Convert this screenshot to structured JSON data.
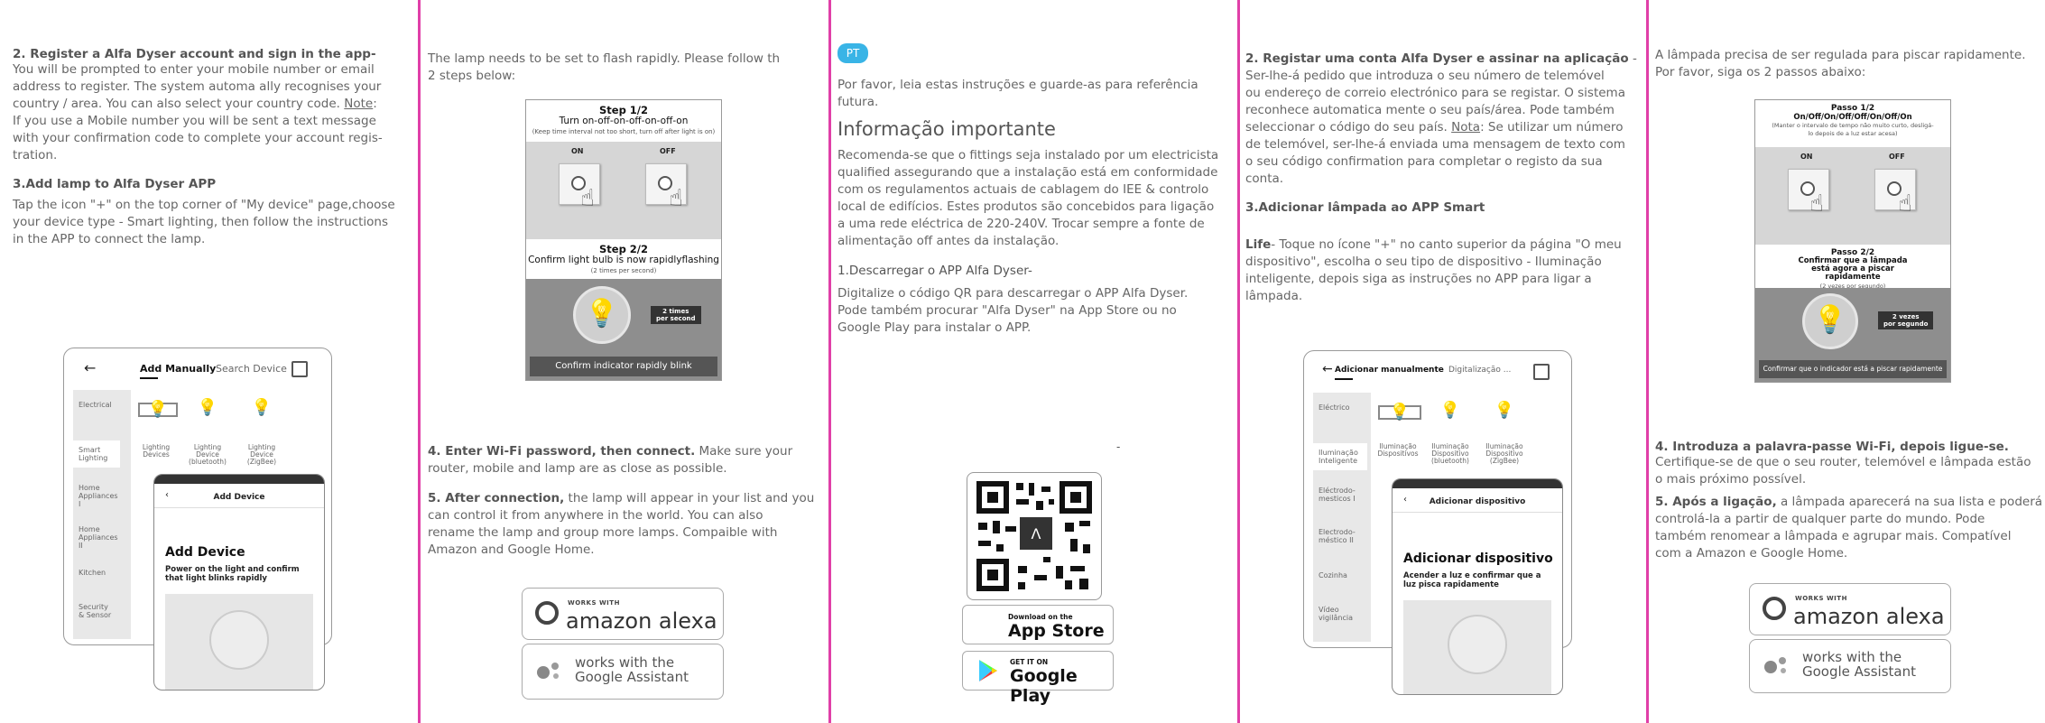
{
  "p1": {
    "h2": "2. Register a Alfa Dyser account and sign in the app-",
    "t2a": "You will be prompted to enter your mobile number or email",
    "t2b": "address to register. The system automa ally recognises your",
    "t2c": "country / area. You can also select your country code.",
    "note": "Note",
    "t2d": ":",
    "t2e": "If you use a Mobile number you will be sent a text message",
    "t2f": "with your confirmation code to complete your account regis-",
    "t2g": "tration.",
    "h3": "3.Add lamp to Alfa Dyser APP",
    "t3a": "Tap the icon \"+\" on the top corner of \"My device\" page,choose",
    "t3b": "your device type - Smart  lighting, then follow the instructions",
    "t3c": "in the APP to  connect the lamp.",
    "phone": {
      "back": "←",
      "add_manually": "Add Manually",
      "search_device": "Search Device",
      "side": [
        "Electrical",
        "Smart Lighting",
        "Home Appliances I",
        "Home Appliances II",
        "Kitchen",
        "Security & Sensor"
      ],
      "tiles": [
        "Lighting Devices",
        "Lighting Device (bluetooth)",
        "Lighting Device (ZigBee)"
      ],
      "inner_header": "Add Device",
      "inner_title": "Add Device",
      "inner_desc": "Power on the light and confirm that light blinks rapidly"
    }
  },
  "p2": {
    "intro_a": "The lamp needs to be set to flash rapidly. Please follow th",
    "intro_b": "2 steps below:",
    "step1": "Step 1/2",
    "step1_text": "Turn on-off-on-off-on-off-on",
    "step1_small": "(Keep time interval not too short, turn off after light is on)",
    "on": "ON",
    "off": "OFF",
    "step2": "Step 2/2",
    "step2_text": "Confirm light bulb is now rapidlyflashing",
    "step2_small": "(2 times per second)",
    "tag": "2 times\nper second",
    "confirm": "Confirm indicator rapidly blink",
    "h4": "4. Enter Wi-Fi password, then connect.",
    "t4a": " Make sure your",
    "t4b": "router, mobile and lamp are as close as possible.",
    "h5": "5. After connection,",
    "t5a": " the lamp will appear in your list and you",
    "t5b": "can control it from anywhere in  the world.  You can also",
    "t5c": "rename the lamp and group more lamps. Compaible with",
    "t5d": "Amazon and Google Home."
  },
  "p3": {
    "badge": "PT",
    "t1a": "Por favor, leia estas instruções e guarde-as para referência",
    "t1b": "futura.",
    "big": "Informação importante",
    "t2a": "Recomenda-se que o fittings seja instalado por um electricista",
    "t2b": "qualified assegurando que a instalação está em conformidade",
    "t2c": "com os regulamentos actuais de cablagem do IEE & controlo",
    "t2d": "local  de edifícios. Estes produtos são concebidos para ligação",
    "t2e": "a uma rede eléctrica de 220-240V. Trocar sempre a fonte de",
    "t2f": "alimentação off antes da instalação.",
    "h3": "1.Descarregar o APP Alfa Dyser-",
    "t3a": "Digitalize o código QR para descarregar o APP Alfa Dyser.",
    "t3b": "Pode também procurar \"Alfa Dyser\" na App Store ou no",
    "t3c": "Google  Play para instalar o APP.",
    "dash": "-",
    "appstore_small": "Download on the",
    "appstore_big": "App Store",
    "gplay_small": "GET IT ON",
    "gplay_big": "Google Play"
  },
  "p4": {
    "h2": "2. Registar uma conta Alfa Dyser e assinar na aplicação",
    "h2b": " -",
    "t2a": "Ser-lhe-á pedido que introduza o seu número de telemóvel",
    "t2b": "ou endereço de correio electrónico para se registar.  O sistema",
    "t2c": "reconhece automatica mente o seu país/área. Pode também",
    "t2d": "seleccionar o código do seu país.",
    "note": "Nota",
    "t2e": ": Se utilizar um número",
    "t2f": "de telemóvel, ser-lhe-á enviada uma mensagem de texto com",
    "t2g": "o seu código confirmation para completar o registo da sua",
    "t2h": "conta.",
    "h3": "3.Adicionar lâmpada ao APP Smart",
    "h3b": "Life",
    "t3a": "- Toque no ícone \"+\" no canto superior da página \"O meu",
    "t3b": "dispositivo\", escolha o seu tipo de dispositivo - Iluminação",
    "t3c": "inteligente,  depois siga as instruções no APP  para ligar a",
    "t3d": "lâmpada.",
    "phone": {
      "back": "←",
      "add_manually": "Adicionar manualmente",
      "search_device": "Digitalização ...",
      "side": [
        "Eléctrico",
        "Iluminação Inteligente",
        "Eléctrodo-mesticos I",
        "Electrodo-méstico II",
        "Cozinha",
        "Vídeo vigilância"
      ],
      "tiles": [
        "Iluminação Dispositivos",
        "Iluminação Dispositivo (bluetooth)",
        "Iluminação Dispositivo (ZigBee)"
      ],
      "inner_header": "Adicionar dispositivo",
      "inner_title": "Adicionar dispositivo",
      "inner_desc": "Acender a luz e confirmar que a luz pisca rapidamente"
    }
  },
  "p5": {
    "intro_a": "A lâmpada precisa de ser regulada para piscar rapidamente.",
    "intro_b": "Por favor, siga os 2 passos abaixo:",
    "step1": "Passo 1/2",
    "step1_text": "On/Off/On/Off/Off/On/Off/On",
    "step1_small": "(Manter o intervalo de tempo não muito curto, desligá-lo depois de a luz estar acesa)",
    "on": "ON",
    "off": "OFF",
    "step2": "Passo 2/2",
    "step2_text": "Confirmar que a lâmpada está agora a piscar rapidamente",
    "step2_small": "(2 vezes por segundo)",
    "tag": "2 vezes\npor segundo",
    "confirm": "Confirmar que o indicador está a piscar rapidamente",
    "h4": "4. Introduza a palavra-passe Wi-Fi, depois ligue-se.",
    "t4a": "Certifique-se de que o seu router, telemóvel e lâmpada estão",
    "t4b": "o mais próximo possível.",
    "h5": "5. Após a ligação,",
    "t5a": " a lâmpada aparecerá na sua lista e poderá",
    "t5b": "controlá-la a partir de qualquer parte do mundo. Pode",
    "t5c": "também renomear a lâmpada e agrupar mais. Compatível",
    "t5d": "com a Amazon e Google Home."
  },
  "badges": {
    "works_with": "WORKS WITH",
    "alexa": "amazon alexa",
    "ga_line1": "works with the",
    "ga_line2": "Google Assistant"
  },
  "colors": {
    "divider": "#e03fa8",
    "pt_badge": "#39b4e6"
  }
}
